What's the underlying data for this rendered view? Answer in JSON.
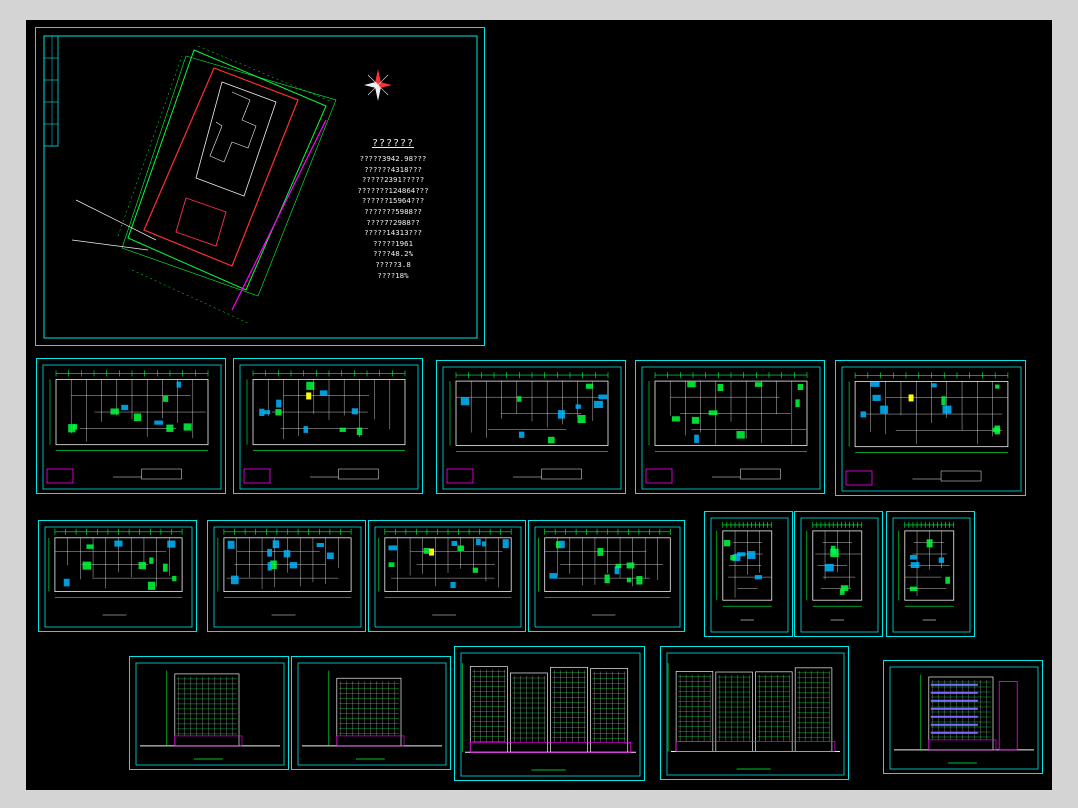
{
  "viewer": {
    "background": "#000000",
    "frame_color": "#00e5e5",
    "accent_colors": {
      "green": "#00ff3c",
      "magenta": "#ff00ff",
      "white": "#f0f0f0",
      "yellow": "#ffff00",
      "red": "#ff2020"
    }
  },
  "site_plan": {
    "icon": "north-arrow-icon",
    "notes_title": "??????",
    "notes": [
      "?????3942.98???",
      "??????4318???",
      "?????2391?????",
      "???????124864???",
      "??????15964???",
      "???????5988??",
      "????7?2988??",
      "?????14313???",
      "?????1961",
      "????48.2%",
      "?????3.8",
      "????18%"
    ]
  },
  "sheets": [
    {
      "id": "site-plan"
    },
    {
      "id": "floor-plan-1"
    },
    {
      "id": "floor-plan-2"
    },
    {
      "id": "floor-plan-3"
    },
    {
      "id": "floor-plan-4"
    },
    {
      "id": "floor-plan-5"
    },
    {
      "id": "typical-plan-1"
    },
    {
      "id": "typical-plan-2"
    },
    {
      "id": "typical-plan-3"
    },
    {
      "id": "typical-plan-4"
    },
    {
      "id": "unit-plan-1"
    },
    {
      "id": "unit-plan-2"
    },
    {
      "id": "unit-plan-3"
    },
    {
      "id": "elevation-1"
    },
    {
      "id": "elevation-2"
    },
    {
      "id": "elevation-3"
    },
    {
      "id": "elevation-4"
    },
    {
      "id": "section-1"
    }
  ]
}
